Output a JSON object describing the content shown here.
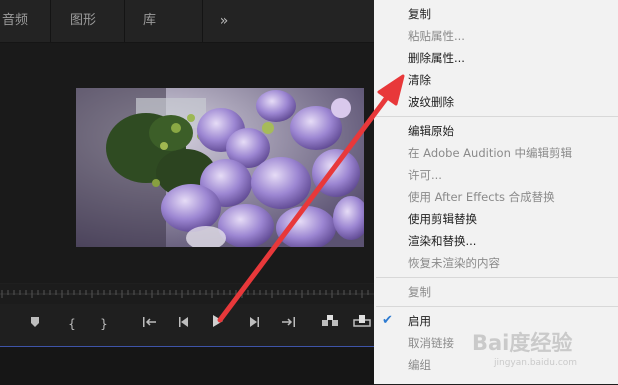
{
  "tabs": {
    "audio": "音频",
    "graphics": "图形",
    "library": "库",
    "more": "»"
  },
  "context_menu": {
    "items": [
      {
        "label": "复制",
        "enabled": true
      },
      {
        "label": "粘贴属性...",
        "enabled": false
      },
      {
        "label": "删除属性...",
        "enabled": true
      },
      {
        "label": "清除",
        "enabled": true
      },
      {
        "label": "波纹删除",
        "enabled": true
      },
      {
        "label": "编辑原始",
        "enabled": true
      },
      {
        "label": "在 Adobe Audition 中编辑剪辑",
        "enabled": false
      },
      {
        "label": "许可...",
        "enabled": false
      },
      {
        "label": "使用 After Effects 合成替换",
        "enabled": false
      },
      {
        "label": "使用剪辑替换",
        "enabled": true
      },
      {
        "label": "渲染和替换...",
        "enabled": true
      },
      {
        "label": "恢复未渲染的内容",
        "enabled": false
      },
      {
        "label": "复制",
        "enabled": false
      },
      {
        "label": "启用",
        "enabled": true,
        "checked": true
      },
      {
        "label": "取消链接",
        "enabled": false
      },
      {
        "label": "编组",
        "enabled": false
      }
    ]
  },
  "watermark": {
    "text": "Bai度经验",
    "sub": "jingyan.baidu.com"
  },
  "colors": {
    "arrow": "#e8383a",
    "accent": "#3e54a8",
    "check": "#2e7bd1",
    "flower": "#8f7ac6"
  },
  "icons": [
    "marker-icon",
    "mark-in-icon",
    "mark-out-icon",
    "go-to-in-icon",
    "step-back-icon",
    "play-icon",
    "step-forward-icon",
    "go-to-out-icon",
    "insert-icon",
    "overwrite-icon",
    "checkmark-icon"
  ]
}
